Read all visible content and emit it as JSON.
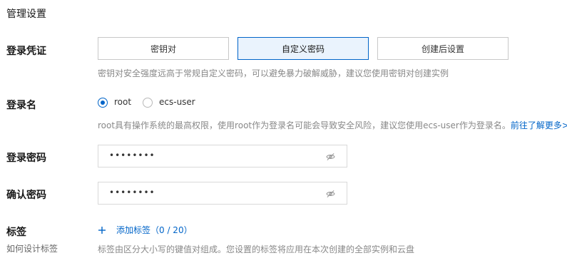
{
  "section_title": "管理设置",
  "login_credential": {
    "label": "登录凭证",
    "options": [
      "密钥对",
      "自定义密码",
      "创建后设置"
    ],
    "selected_index": 1,
    "hint": "密钥对安全强度远高于常规自定义密码，可以避免暴力破解威胁，建议您使用密钥对创建实例"
  },
  "login_name": {
    "label": "登录名",
    "options": [
      "root",
      "ecs-user"
    ],
    "selected": "root",
    "hint": "root具有操作系统的最高权限，使用root作为登录名可能会导致安全风险，建议您使用ecs-user作为登录名。",
    "learn_more": "前往了解更多>"
  },
  "password": {
    "label": "登录密码",
    "value": "••••••••",
    "eye_icon": "eye-off-icon"
  },
  "confirm_password": {
    "label": "确认密码",
    "value": "••••••••",
    "eye_icon": "eye-off-icon"
  },
  "tags": {
    "label": "标签",
    "sublabel": "如何设计标签",
    "add_icon": "plus-icon",
    "add_label": "添加标签（0 / 20）",
    "hint": "标签由区分大小写的键值对组成。您设置的标签将应用在本次创建的全部实例和云盘"
  },
  "colors": {
    "accent": "#0064c8",
    "selected_bg": "#eaf3fd"
  }
}
